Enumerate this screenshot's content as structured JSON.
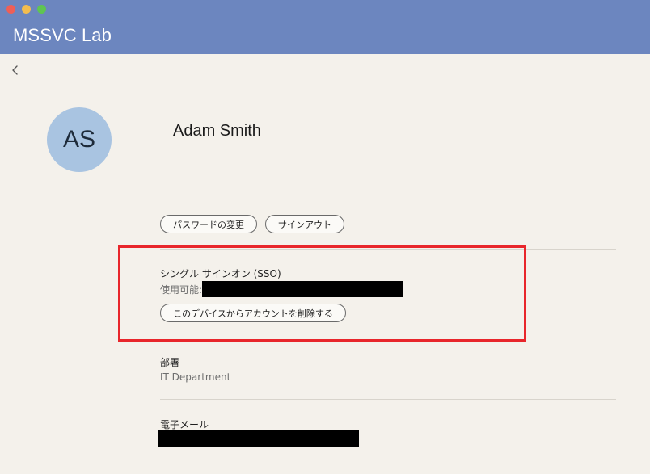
{
  "window": {
    "title": "MSSVC Lab"
  },
  "profile": {
    "initials": "AS",
    "name": "Adam Smith",
    "avatar_color": "#a9c4e1"
  },
  "actions": {
    "change_password": "パスワードの変更",
    "sign_out": "サインアウト"
  },
  "sso": {
    "title": "シングル サインオン (SSO)",
    "available_label": "使用可能:",
    "remove_account": "このデバイスからアカウントを削除する"
  },
  "department": {
    "label": "部署",
    "value": "IT Department"
  },
  "email": {
    "label": "電子メール"
  },
  "colors": {
    "header": "#6c86bf",
    "highlight": "#e8262b",
    "background": "#f4f1eb"
  },
  "icons": {
    "back": "chevron-left-icon"
  }
}
